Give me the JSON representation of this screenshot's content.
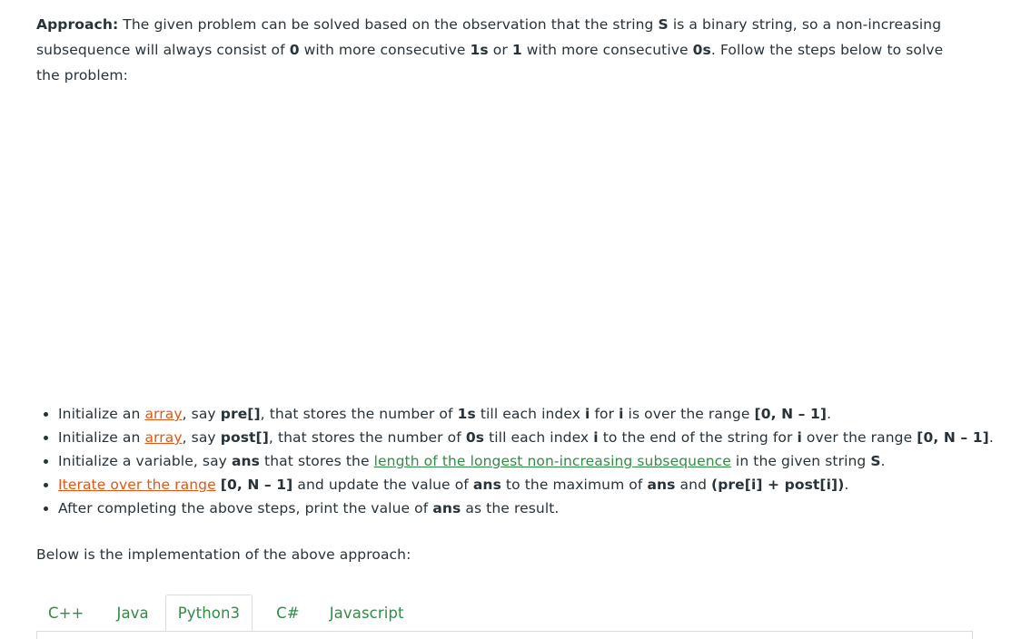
{
  "approach": {
    "label": "Approach:",
    "t1": " The given problem can be solved based on the observation that the string ",
    "s1": "S",
    "t2": " is a binary string, so a non-increasing subsequence will always consist of ",
    "zero1": "0",
    "t3": " with more consecutive ",
    "ones1": "1s",
    "t4": " or ",
    "one1": "1",
    "t5": " with more consecutive ",
    "zeros1": "0s",
    "t6": ". Follow the steps below to solve the problem:"
  },
  "steps": [
    {
      "a": "Initialize an ",
      "link": "array",
      "b": ", say ",
      "c": "pre[]",
      "d": ", that stores the number of ",
      "e": "1s",
      "f": " till each index ",
      "g": "i",
      "h": " for ",
      "i": "i",
      "j": " is over the range ",
      "k": "[0, N – 1]",
      "l": "."
    },
    {
      "a": "Initialize an ",
      "link": "array",
      "b": ", say ",
      "c": "post[]",
      "d": ", that stores the number of ",
      "e": "0s",
      "f": " till each index ",
      "g": "i",
      "h": " to the end of the string for ",
      "i": "i",
      "j": " over the range ",
      "k": "[0, N – 1]",
      "l": "."
    },
    {
      "a": "Initialize a variable, say ",
      "b": "ans",
      "c": " that stores the ",
      "link": "length of the longest non-increasing subsequence",
      "d": " in the given string ",
      "e": "S",
      "f": "."
    },
    {
      "link": "Iterate over the range",
      "a": " ",
      "b": "[0, N – 1]",
      "c": " and update the value of ",
      "d": "ans",
      "e": " to the maximum of ",
      "f": "ans",
      "g": " and ",
      "h": "(pre[i] + post[i])",
      "i": "."
    },
    {
      "a": "After completing the above steps, print the value of ",
      "b": "ans",
      "c": " as the result."
    }
  ],
  "below_text": "Below is the implementation of the above approach:",
  "tabs": {
    "items": [
      "C++",
      "Java",
      "Python3",
      "C#",
      "Javascript"
    ],
    "active": "Python3"
  },
  "colors": {
    "text": "#273239",
    "link_orange": "#e15713",
    "link_green": "#2f8d46",
    "tab_border": "#dcdcdc"
  }
}
